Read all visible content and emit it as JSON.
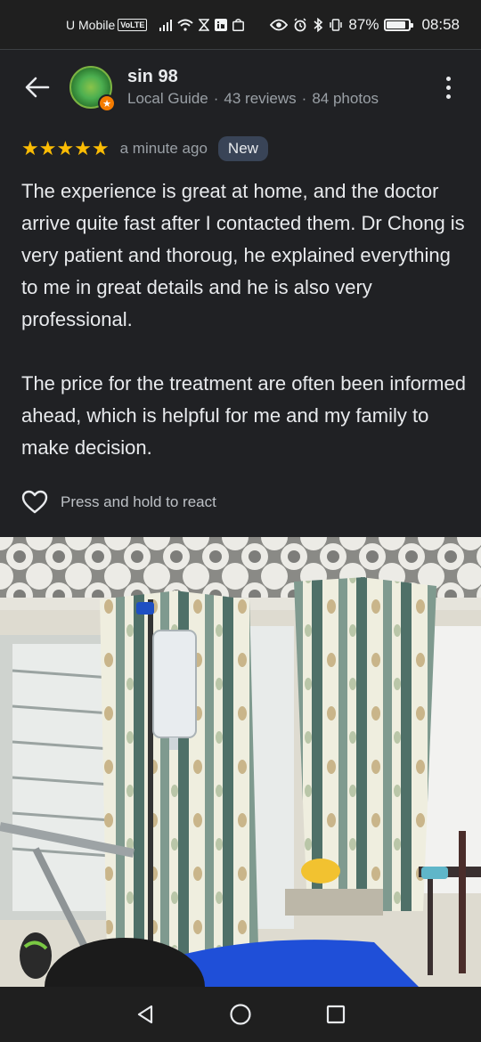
{
  "status_bar": {
    "carrier": "U Mobile",
    "volte": "VoLTE",
    "battery": "87%",
    "battery_level": 0.87,
    "time": "08:58"
  },
  "header": {
    "user_name": "sin 98",
    "role": "Local Guide",
    "reviews": "43 reviews",
    "photos": "84 photos",
    "separator": "·"
  },
  "review": {
    "stars": "★★★★★",
    "rating": 5,
    "time": "a minute ago",
    "badge": "New",
    "paragraph_1": "The experience is great at home, and the doctor arrive quite fast after I contacted them. Dr Chong is very patient and thoroug, he explained everything to me in great details and he is also very professional.",
    "paragraph_2": "The price for the treatment are often been informed ahead, which is helpful for me and my family to make decision."
  },
  "react": {
    "label": "Press and hold to react"
  },
  "colors": {
    "background": "#202124",
    "star": "#fbbc04",
    "badge_bg": "#394457",
    "text_primary": "#e8eaed",
    "text_secondary": "#9aa0a6"
  },
  "icons": {
    "back": "arrow-left-icon",
    "more": "more-vert-icon",
    "heart": "heart-outline-icon",
    "nav_back": "triangle-back-icon",
    "nav_home": "circle-home-icon",
    "nav_recent": "square-recent-icon"
  }
}
